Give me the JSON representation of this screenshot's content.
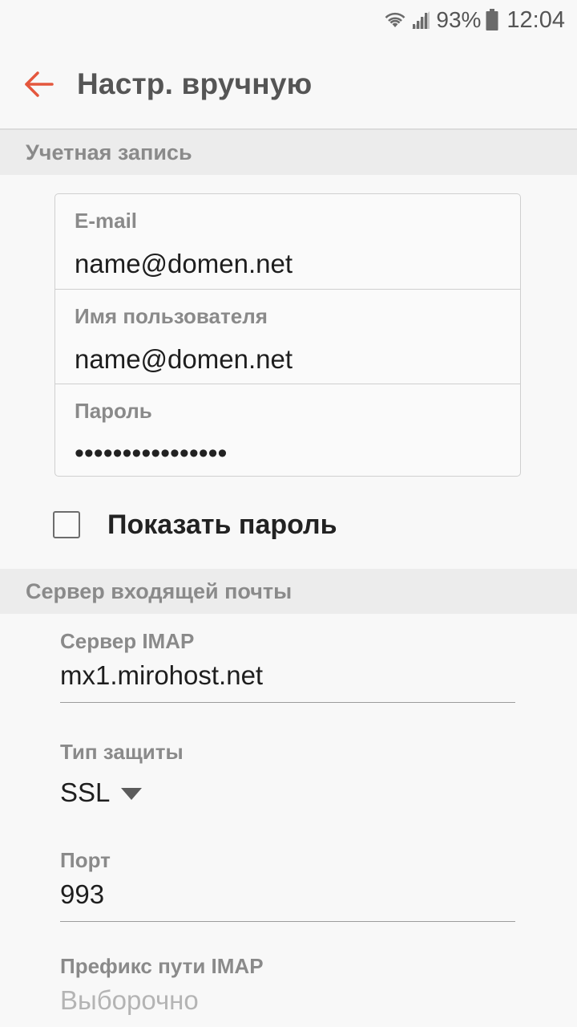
{
  "status_bar": {
    "battery_percent": "93%",
    "time": "12:04",
    "icons": [
      "wifi-icon",
      "signal-icon",
      "battery-icon"
    ]
  },
  "app_bar": {
    "title": "Настр. вручную",
    "back_icon": "back-arrow-icon",
    "accent_color": "#e4573d"
  },
  "account_section": {
    "header": "Учетная запись",
    "email_label": "E-mail",
    "email_value": "name@domen.net",
    "username_label": "Имя пользователя",
    "username_value": "name@domen.net",
    "password_label": "Пароль",
    "password_value": "••••••••••••••••",
    "show_password_label": "Показать пароль",
    "show_password_checked": false
  },
  "incoming_section": {
    "header": "Сервер входящей почты",
    "server_label": "Сервер IMAP",
    "server_value": "mx1.mirohost.net",
    "security_label": "Тип защиты",
    "security_value": "SSL",
    "port_label": "Порт",
    "port_value": "993",
    "prefix_label": "Префикс пути IMAP",
    "prefix_placeholder": "Выборочно"
  }
}
